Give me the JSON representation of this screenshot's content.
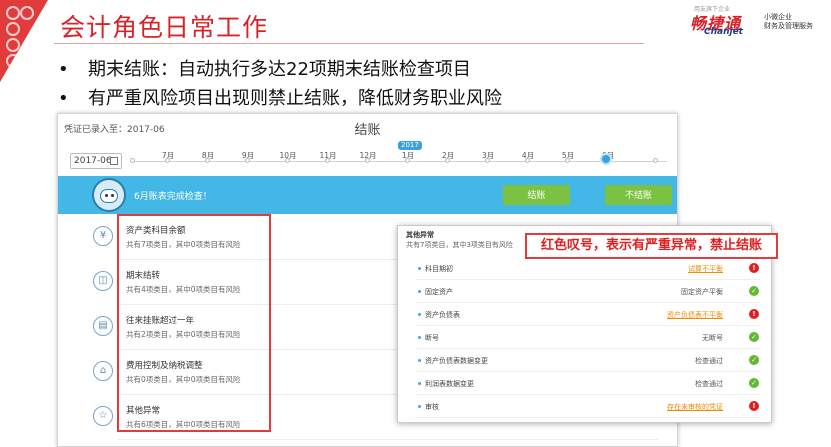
{
  "slide": {
    "title": "会计角色日常工作",
    "bullets": [
      "期末结账：自动执行多达22项期末结账检查项目",
      "有严重风险项目出现则禁止结账，降低财务职业风险"
    ]
  },
  "logo": {
    "tag": "用友旗下企业",
    "brand": "畅捷通",
    "brand_en": "Chanjet",
    "slogan_line1": "小微企业",
    "slogan_line2": "财务及管理服务"
  },
  "panel": {
    "voucher_status": "凭证已录入至：2017-06",
    "title": "结账",
    "period_value": "2017-06",
    "timeline": {
      "year_badge": "2017",
      "months": [
        "7月",
        "8月",
        "9月",
        "10月",
        "11月",
        "12月",
        "1月",
        "2月",
        "3月",
        "4月",
        "5月",
        "6月"
      ],
      "active_index": 11
    },
    "banner": {
      "message": "6月账表完成检查！",
      "close_button": "结账",
      "no_close_button": "不结账"
    },
    "categories": [
      {
        "icon": "yen-icon",
        "glyph": "¥",
        "title": "资产类科目余额",
        "summary": "共有7项类目，其中0项类目有风险"
      },
      {
        "icon": "transfer-icon",
        "glyph": "◫",
        "title": "期末结转",
        "summary": "共有4项类目，其中0项类目有风险"
      },
      {
        "icon": "document-icon",
        "glyph": "▤",
        "title": "往来挂账超过一年",
        "summary": "共有2项类目，其中0项类目有风险"
      },
      {
        "icon": "tax-icon",
        "glyph": "⌂",
        "title": "费用控制及纳税调整",
        "summary": "共有0项类目，其中0项类目有风险"
      },
      {
        "icon": "star-icon",
        "glyph": "☆",
        "title": "其他异常",
        "summary": "共有6项类目，其中0项类目有风险"
      }
    ]
  },
  "popup": {
    "title": "其他异常",
    "summary": "共有7项类目，其中3项类目有风险",
    "items": [
      {
        "name": "科目期初",
        "status": "试算不平衡",
        "link": true,
        "result": "error"
      },
      {
        "name": "固定资产",
        "status": "固定资产平衡",
        "link": false,
        "result": "ok"
      },
      {
        "name": "资产负债表",
        "status": "资产负债表不平衡",
        "link": true,
        "result": "error"
      },
      {
        "name": "断号",
        "status": "无断号",
        "link": false,
        "result": "ok"
      },
      {
        "name": "资产负债表数据变更",
        "status": "检查通过",
        "link": false,
        "result": "ok"
      },
      {
        "name": "利润表数据变更",
        "status": "检查通过",
        "link": false,
        "result": "ok"
      },
      {
        "name": "审核",
        "status": "存在未审核的凭证",
        "link": true,
        "result": "error"
      }
    ]
  },
  "callout": {
    "text": "红色叹号，表示有严重异常，禁止结账"
  },
  "colors": {
    "brand_red": "#d9232a",
    "banner_blue": "#43b7e6",
    "button_green": "#7cc242",
    "error_red": "#e02020",
    "ok_green": "#62b833",
    "warning_orange": "#f08a00"
  }
}
